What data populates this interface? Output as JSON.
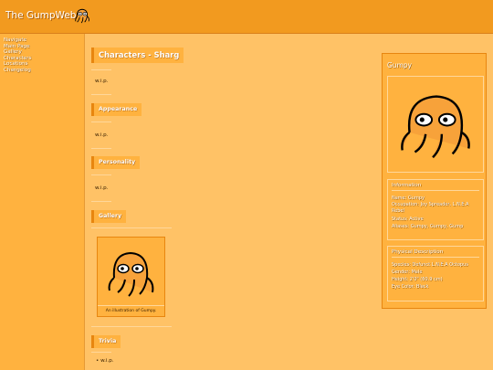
{
  "site": {
    "title": "The GumpWeb",
    "logo_icon": "octopus-logo-icon"
  },
  "nav": {
    "heading": "Navigate",
    "items": [
      "Main Page",
      "Gallery",
      "Characters",
      "Locations",
      "Changelog"
    ]
  },
  "main": {
    "title": "Characters - Sharg",
    "intro_text": "w.i.p.",
    "sections": [
      {
        "title": "Appearance",
        "text": "w.i.p."
      },
      {
        "title": "Personality",
        "text": "w.i.p."
      },
      {
        "title": "Gallery"
      },
      {
        "title": "Trivia"
      }
    ],
    "gallery": {
      "caption": "An illustration of Gumpy."
    },
    "trivia_items": [
      "w.i.p."
    ]
  },
  "infobox": {
    "name": "Gumpy",
    "information": {
      "title": "Information",
      "rows": [
        "Name: Gumpy",
        "Occupation: Joy Spreader, L.N.E.A Rebel",
        "Status: Active",
        "Aliases: Gumpy, Gumpy, Gump"
      ]
    },
    "physical": {
      "title": "Physical Description",
      "rows": [
        "Species: Defunct L.N.E.A Octopus",
        "Gender: Male",
        "Height: 2'0\" (60.9 cm)",
        "Eye Color: Black"
      ]
    }
  },
  "colors": {
    "header": "#f29a1f",
    "sidebar": "#ffb23f",
    "page": "#ffc266",
    "accent": "#e8860f"
  }
}
